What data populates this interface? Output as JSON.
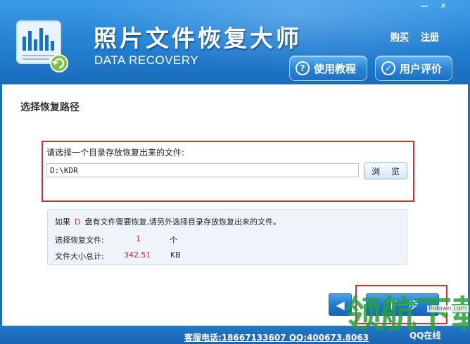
{
  "header": {
    "app_title": "照片文件恢复大师",
    "app_subtitle": "DATA RECOVERY",
    "window_minimize": "—",
    "window_close": "✕",
    "link_buy": "购买",
    "link_register": "注册",
    "btn_tutorial": "使用教程",
    "btn_review": "用户评价"
  },
  "main": {
    "section_title": "选择恢复路径",
    "prompt_label": "请选择一个目录存放恢复出来的文件:",
    "path_value": "D:\\KDR",
    "browse_label": "浏 览",
    "info": {
      "line_prefix": "如果",
      "drive": "D",
      "line_suffix": "盘有文件需要恢复,请另外选择目录存放恢复出来的文件。",
      "files_label": "选择恢复文件:",
      "files_count": "1",
      "files_unit": "个",
      "size_label": "文件大小总计:",
      "size_value": "342.51",
      "size_unit": "KB"
    },
    "back_icon": "◀",
    "next_label": "下一步"
  },
  "footer": {
    "contact": "客服电话:18667133607 QQ:400673.8063",
    "qq_online": "QQ在线"
  },
  "watermark": {
    "text": "领航下载",
    "site": "lhdown.com"
  },
  "colors": {
    "header_blue": "#2480d2",
    "highlight_red": "#e5292c",
    "value_red": "#e02020"
  }
}
